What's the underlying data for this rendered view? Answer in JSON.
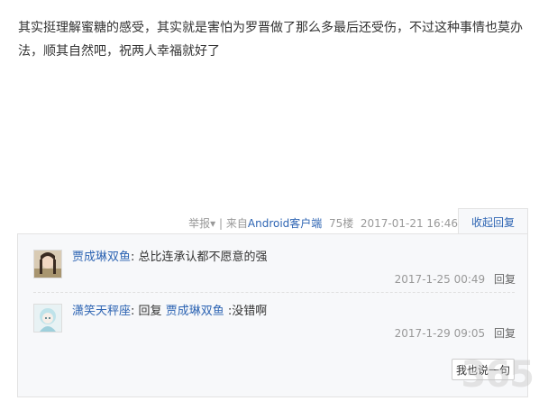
{
  "post": {
    "text": "其实挺理解蜜糖的感受，其实就是害怕为罗晋做了那么多最后还受伤，不过这种事情也莫办法，顺其自然吧，祝两人幸福就好了",
    "report": "举报▾",
    "separator": "|",
    "from_label": "来自",
    "client": "Android客户端",
    "floor": "75楼",
    "datetime": "2017-01-21 16:46",
    "collapse_label": "收起回复"
  },
  "replies": [
    {
      "username": "贾成琳双鱼",
      "colon": ":",
      "content": "总比连承认都不愿意的强",
      "datetime": "2017-1-25 00:49",
      "reply_label": "回复"
    },
    {
      "username": "潇笑天秤座",
      "colon": ":",
      "prefix": "回复",
      "mention": "贾成琳双鱼",
      "content": ":没错啊",
      "datetime": "2017-1-29 09:05",
      "reply_label": "回复"
    }
  ],
  "say_button": "我也说一句",
  "watermark": "365"
}
